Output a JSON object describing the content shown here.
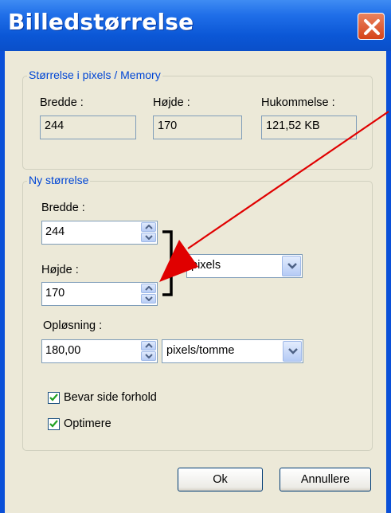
{
  "window": {
    "title": "Billedstørrelse"
  },
  "current": {
    "legend": "Størrelse i pixels / Memory",
    "width_label": "Bredde :",
    "width_value": "244",
    "height_label": "Højde :",
    "height_value": "170",
    "memory_label": "Hukommelse :",
    "memory_value": "121,52 KB"
  },
  "new_size": {
    "legend": "Ny størrelse",
    "width_label": "Bredde :",
    "width_value": "244",
    "height_label": "Højde :",
    "height_value": "170",
    "unit_selected": "pixels",
    "resolution_label": "Opløsning :",
    "resolution_value": "180,00",
    "resolution_unit_selected": "pixels/tomme"
  },
  "options": {
    "keep_aspect_label": "Bevar side forhold",
    "keep_aspect_checked": true,
    "optimize_label": "Optimere",
    "optimize_checked": true
  },
  "buttons": {
    "ok": "Ok",
    "cancel": "Annullere"
  },
  "colors": {
    "titlebar": "#0a58d8",
    "legend_text": "#0046d5",
    "arrow": "#e00000"
  }
}
